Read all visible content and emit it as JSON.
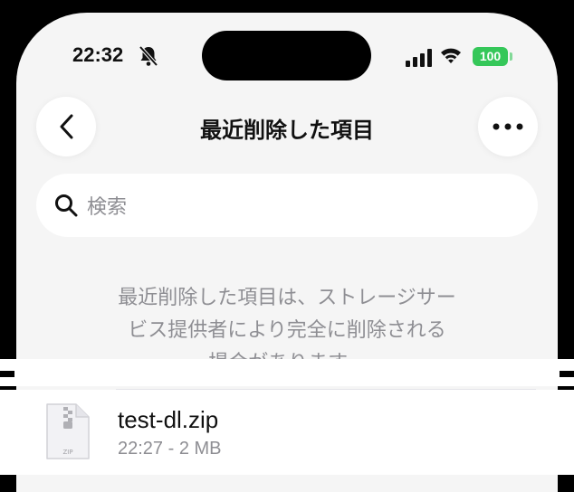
{
  "status_bar": {
    "time": "22:32",
    "battery": "100",
    "colors": {
      "battery": "#35c759"
    },
    "icons": [
      "bell-slash-icon",
      "cellular-signal-icon",
      "wifi-icon"
    ]
  },
  "nav": {
    "title": "最近削除した項目",
    "back_icon": "chevron-left-icon",
    "more_icon": "ellipsis-icon"
  },
  "search": {
    "placeholder": "検索",
    "icon": "search-icon"
  },
  "info": {
    "lines": [
      "最近削除した項目は、ストレージサー",
      "ビス提供者により完全に削除される",
      "場合があります。"
    ]
  },
  "files": [
    {
      "name": "test-dl.zip",
      "meta": "22:27 - 2 MB",
      "icon": "zip-file-icon",
      "icon_label": "ZIP"
    }
  ]
}
